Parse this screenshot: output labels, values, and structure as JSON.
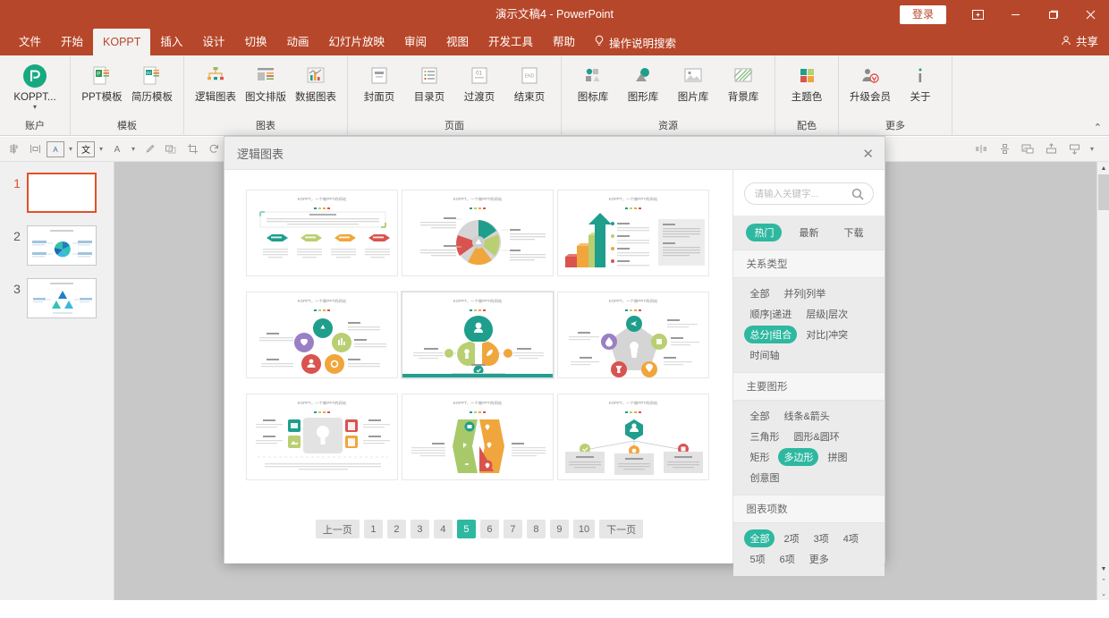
{
  "titlebar": {
    "document_title": "演示文稿4  -  PowerPoint",
    "signin_label": "登录",
    "restore_down_icon": "restore-icon",
    "minimize_icon": "minimize-icon",
    "maximize_icon": "maximize-icon",
    "close_icon": "close-icon",
    "accent_color": "#b7472a"
  },
  "menubar": {
    "items": [
      {
        "label": "文件",
        "active": false
      },
      {
        "label": "开始",
        "active": false
      },
      {
        "label": "KOPPT",
        "active": true
      },
      {
        "label": "插入",
        "active": false
      },
      {
        "label": "设计",
        "active": false
      },
      {
        "label": "切换",
        "active": false
      },
      {
        "label": "动画",
        "active": false
      },
      {
        "label": "幻灯片放映",
        "active": false
      },
      {
        "label": "审阅",
        "active": false
      },
      {
        "label": "视图",
        "active": false
      },
      {
        "label": "开发工具",
        "active": false
      },
      {
        "label": "帮助",
        "active": false
      }
    ],
    "tellme_label": "操作说明搜索",
    "share_label": "共享"
  },
  "ribbon": {
    "collapse_icon": "chevron-up-icon",
    "groups": [
      {
        "label": "账户",
        "buttons": [
          {
            "label": "KOPPT...",
            "icon": "koppt-logo-icon",
            "dropdown": true
          }
        ]
      },
      {
        "label": "模板",
        "buttons": [
          {
            "label": "PPT模板",
            "icon": "ppt-template-icon"
          },
          {
            "label": "简历模板",
            "icon": "resume-template-icon"
          }
        ]
      },
      {
        "label": "图表",
        "buttons": [
          {
            "label": "逻辑图表",
            "icon": "logic-chart-icon"
          },
          {
            "label": "图文排版",
            "icon": "text-image-layout-icon"
          },
          {
            "label": "数据图表",
            "icon": "data-chart-icon"
          }
        ]
      },
      {
        "label": "页面",
        "buttons": [
          {
            "label": "封面页",
            "icon": "cover-page-icon"
          },
          {
            "label": "目录页",
            "icon": "toc-page-icon"
          },
          {
            "label": "过渡页",
            "icon": "transition-page-icon"
          },
          {
            "label": "结束页",
            "icon": "end-page-icon"
          }
        ]
      },
      {
        "label": "资源",
        "buttons": [
          {
            "label": "图标库",
            "icon": "icon-library-icon"
          },
          {
            "label": "图形库",
            "icon": "shape-library-icon"
          },
          {
            "label": "图片库",
            "icon": "image-library-icon"
          },
          {
            "label": "背景库",
            "icon": "background-library-icon"
          }
        ]
      },
      {
        "label": "配色",
        "buttons": [
          {
            "label": "主题色",
            "icon": "theme-color-icon"
          }
        ]
      },
      {
        "label": "更多",
        "buttons": [
          {
            "label": "升级会员",
            "icon": "upgrade-member-icon"
          },
          {
            "label": "关于",
            "icon": "about-info-icon"
          }
        ]
      }
    ]
  },
  "toolbar2": {
    "left_icons": [
      "align-icon",
      "distribute-icon",
      "text-direction-icon",
      "chevron-down-icon",
      "chinese-text-icon",
      "chevron-down-icon",
      "font-size-icon",
      "chevron-down-icon",
      "eyedropper-icon",
      "shape-effect-icon",
      "crop-icon",
      "rotate-icon"
    ],
    "right_icons": [
      "align-center-icon",
      "align-vertical-icon",
      "picture-tools-icon",
      "bring-front-icon",
      "send-back-icon",
      "overflow-chevron-icon"
    ]
  },
  "slide_panel": {
    "slides": [
      {
        "number": "1",
        "selected": true,
        "kind": "blank"
      },
      {
        "number": "2",
        "selected": false,
        "kind": "pinwheel-diagram"
      },
      {
        "number": "3",
        "selected": false,
        "kind": "triangle-diagram"
      }
    ]
  },
  "scrollbar": {
    "up_arrow_icon": "chevron-up-icon",
    "down_arrow_icon": "chevron-down-icon",
    "prev_slide_icon": "double-chevron-up-icon",
    "next_slide_icon": "double-chevron-down-icon"
  },
  "dialog": {
    "title": "逻辑图表",
    "close_icon": "close-icon",
    "search": {
      "placeholder": "请输入关键字...",
      "value": "",
      "icon": "search-icon"
    },
    "sort_tabs": [
      {
        "label": "热门",
        "active": true
      },
      {
        "label": "最新",
        "active": false
      },
      {
        "label": "下载",
        "active": false
      }
    ],
    "filter_sections": [
      {
        "heading": "关系类型",
        "options": [
          {
            "label": "全部",
            "active": false
          },
          {
            "label": "并列|列举",
            "active": false
          },
          {
            "label": "顺序|递进",
            "active": false
          },
          {
            "label": "层级|层次",
            "active": false
          },
          {
            "label": "总分|组合",
            "active": true
          },
          {
            "label": "对比|冲突",
            "active": false
          },
          {
            "label": "时间轴",
            "active": false
          }
        ]
      },
      {
        "heading": "主要图形",
        "options": [
          {
            "label": "全部",
            "active": false
          },
          {
            "label": "线条&箭头",
            "active": false
          },
          {
            "label": "三角形",
            "active": false
          },
          {
            "label": "圆形&圆环",
            "active": false
          },
          {
            "label": "矩形",
            "active": false
          },
          {
            "label": "多边形",
            "active": true
          },
          {
            "label": "拼图",
            "active": false
          },
          {
            "label": "创意图",
            "active": false
          }
        ]
      },
      {
        "heading": "图表项数",
        "options": [
          {
            "label": "全部",
            "active": true
          },
          {
            "label": "2项",
            "active": false
          },
          {
            "label": "3项",
            "active": false
          },
          {
            "label": "4项",
            "active": false
          },
          {
            "label": "5项",
            "active": false
          },
          {
            "label": "6项",
            "active": false
          },
          {
            "label": "更多",
            "active": false
          }
        ]
      }
    ],
    "templates": [
      {
        "id": "tpl-1",
        "title": "KOPPT，一个做PPT的网站",
        "kind": "hexagon-row",
        "selected": false
      },
      {
        "id": "tpl-2",
        "title": "KOPPT，一个做PPT的网站",
        "kind": "pinwheel",
        "selected": false
      },
      {
        "id": "tpl-3",
        "title": "KOPPT，一个做PPT的网站",
        "kind": "arrow-steps",
        "selected": false
      },
      {
        "id": "tpl-4",
        "title": "KOPPT，一个做PPT的网站",
        "kind": "circle-ring",
        "selected": false
      },
      {
        "id": "tpl-5",
        "title": "KOPPT，一个做PPT的网站",
        "kind": "leaf-trio",
        "selected": true
      },
      {
        "id": "tpl-6",
        "title": "KOPPT，一个做PPT的网站",
        "kind": "pentagon",
        "selected": false
      },
      {
        "id": "tpl-7",
        "title": "KOPPT，一个做PPT的网站",
        "kind": "icon-grid",
        "selected": false
      },
      {
        "id": "tpl-8",
        "title": "KOPPT，一个做PPT的网站",
        "kind": "chevron-pair",
        "selected": false
      },
      {
        "id": "tpl-9",
        "title": "KOPPT，一个做PPT的网站",
        "kind": "org-tree",
        "selected": false
      }
    ],
    "pagination": {
      "prev_label": "上一页",
      "next_label": "下一页",
      "pages": [
        "1",
        "2",
        "3",
        "4",
        "5",
        "6",
        "7",
        "8",
        "9",
        "10"
      ],
      "current": "5"
    },
    "accent_color": "#2eb8a0"
  }
}
